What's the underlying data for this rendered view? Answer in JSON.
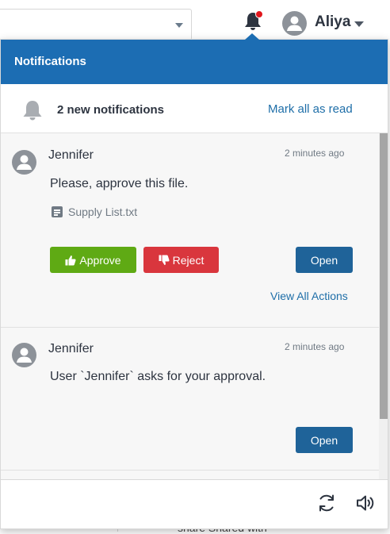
{
  "header": {
    "user_name": "Aliya"
  },
  "panel": {
    "title": "Notifications",
    "summary": "2 new notifications",
    "mark_all_label": "Mark all as read"
  },
  "notifications": [
    {
      "sender": "Jennifer",
      "time": "2 minutes ago",
      "message": "Please, approve this file.",
      "file_name": "Supply List.txt",
      "approve_label": "Approve",
      "reject_label": "Reject",
      "open_label": "Open",
      "view_all_label": "View All Actions"
    },
    {
      "sender": "Jennifer",
      "time": "2 minutes ago",
      "message": "User `Jennifer` asks for your approval.",
      "open_label": "Open"
    }
  ],
  "background": {
    "partial_text": "share Shared with"
  },
  "icons": {
    "header_bell": "bell-icon",
    "summary_bell": "bell-icon",
    "avatar": "user-avatar-icon",
    "file": "file-text-icon",
    "approve": "thumbs-up-icon",
    "reject": "thumbs-down-icon",
    "refresh": "refresh-icon",
    "sound": "volume-icon"
  },
  "colors": {
    "header_blue": "#1c6db3",
    "approve_green": "#5faa14",
    "reject_red": "#d9363d",
    "open_blue": "#1f6399",
    "link_blue": "#1e6ea8",
    "alert_dot": "#e0161c"
  }
}
